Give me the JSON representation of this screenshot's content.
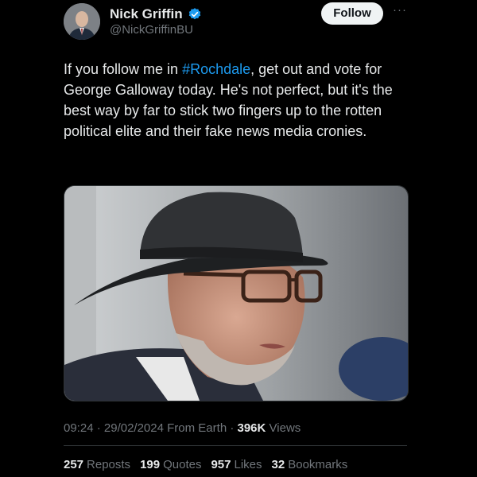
{
  "author": {
    "name": "Nick Griffin",
    "handle": "@NickGriffinBU",
    "verified": true
  },
  "follow_label": "Follow",
  "more_icon": "more-horizontal-icon",
  "tweet": {
    "text_before": "If you follow me in ",
    "hashtag": "#Rochdale",
    "text_after": ", get out and vote for George Galloway today. He's not perfect, but it's the best way by far to stick two fingers up to the rotten political elite and their fake news media cronies."
  },
  "meta": {
    "time": "09:24",
    "separator": "·",
    "date": "29/02/2024",
    "source": "From Earth",
    "views_count": "396K",
    "views_label": "Views"
  },
  "stats": {
    "reposts": {
      "count": "257",
      "label": "Reposts"
    },
    "quotes": {
      "count": "199",
      "label": "Quotes"
    },
    "likes": {
      "count": "957",
      "label": "Likes"
    },
    "bookmarks": {
      "count": "32",
      "label": "Bookmarks"
    }
  },
  "colors": {
    "background": "#000000",
    "accent": "#1d9bf0",
    "text": "#e7e9ea",
    "muted": "#71767b"
  }
}
